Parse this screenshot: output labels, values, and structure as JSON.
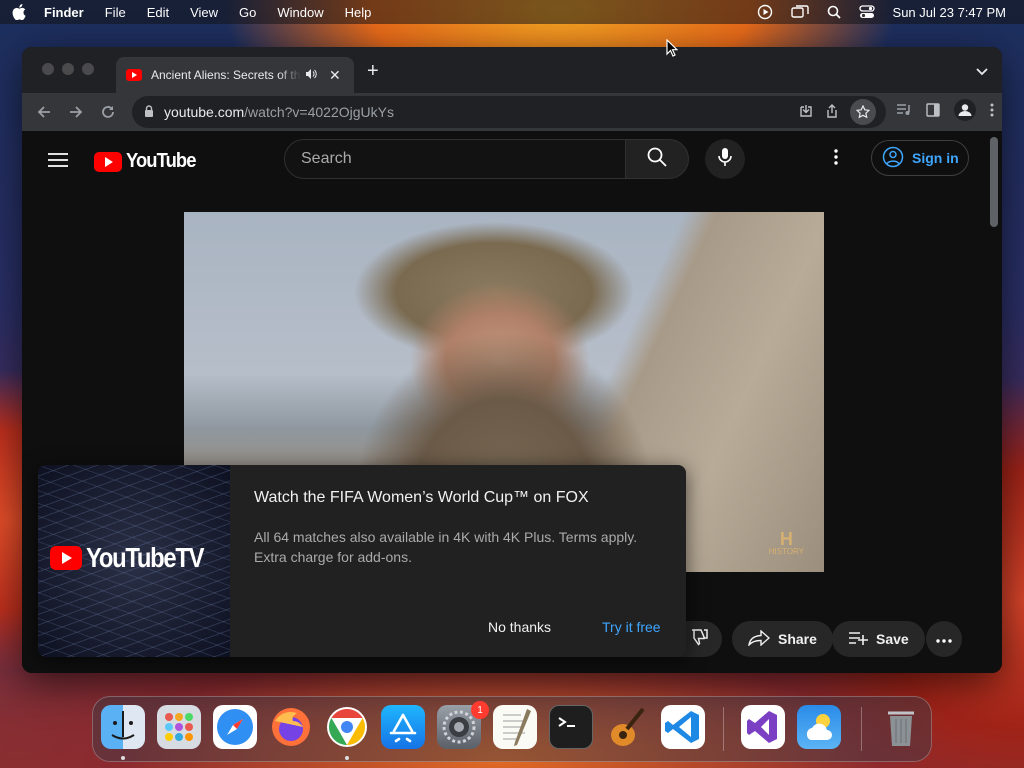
{
  "menubar": {
    "app": "Finder",
    "items": [
      "File",
      "Edit",
      "View",
      "Go",
      "Window",
      "Help"
    ],
    "clock": "Sun Jul 23  7:47 PM"
  },
  "browser": {
    "tab_title": "Ancient Aliens: Secrets of the",
    "url_domain": "youtube.com",
    "url_path": "/watch?v=4022OjgUkYs"
  },
  "youtube": {
    "logo_text": "YouTube",
    "search_placeholder": "Search",
    "signin_label": "Sign in",
    "video_watermark": "HISTORY",
    "share_label": "Share",
    "save_label": "Save"
  },
  "promo": {
    "logo_text": "YouTubeTV",
    "title": "Watch the FIFA Women’s World Cup™ on FOX",
    "body": "All 64 matches also available in 4K with 4K Plus. Terms apply. Extra charge for add-ons.",
    "no_thanks": "No thanks",
    "try_free": "Try it free"
  },
  "dock": {
    "apps": [
      "finder",
      "launchpad",
      "safari",
      "firefox",
      "chrome",
      "app-store",
      "system-settings",
      "textedit",
      "terminal",
      "garageband",
      "vscode",
      "visual-studio",
      "weather",
      "trash"
    ],
    "settings_badge": "1",
    "colors": {
      "finder": "#3b8de8",
      "chrome": "#e8453c",
      "vscode": "#1e88e5",
      "vs": "#7b3fc4",
      "weather": "#2a8be8"
    }
  }
}
